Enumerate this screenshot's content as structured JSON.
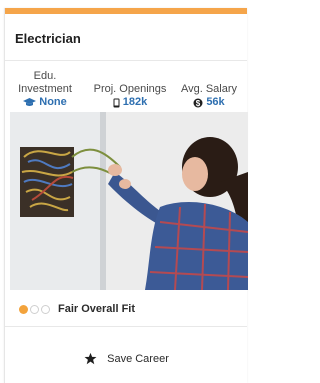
{
  "card": {
    "title": "Electrician",
    "accent_color": "#f5a54a"
  },
  "stats": {
    "edu": {
      "label_line1": "Edu.",
      "label_line2": "Investment",
      "value": "None",
      "icon": "graduation-cap-icon"
    },
    "openings": {
      "label": "Proj. Openings",
      "value": "182k",
      "icon": "phone-icon"
    },
    "salary": {
      "label": "Avg. Salary",
      "value": "56k",
      "icon": "dollar-circle-icon"
    }
  },
  "photo": {
    "alt": "Electrician working on exposed wires in a wall"
  },
  "fit": {
    "label": "Fair Overall Fit",
    "level": 1,
    "max": 3
  },
  "save": {
    "label": "Save Career",
    "icon": "star-icon"
  }
}
